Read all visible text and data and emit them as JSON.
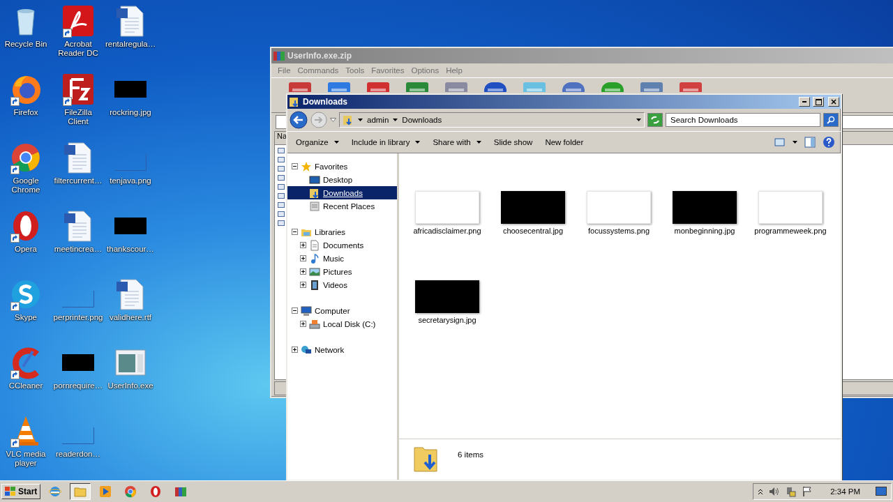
{
  "desktop": {
    "icons": [
      {
        "label": "Recycle Bin",
        "kind": "recycle",
        "shortcut": false
      },
      {
        "label": "Acrobat Reader DC",
        "kind": "acrobat",
        "shortcut": true
      },
      {
        "label": "rentalregula…",
        "kind": "doc",
        "shortcut": false
      },
      {
        "label": "Firefox",
        "kind": "firefox",
        "shortcut": true
      },
      {
        "label": "FileZilla Client",
        "kind": "filezilla",
        "shortcut": true
      },
      {
        "label": "rockring.jpg",
        "kind": "thumb-dark",
        "shortcut": false
      },
      {
        "label": "Google Chrome",
        "kind": "chrome",
        "shortcut": true
      },
      {
        "label": "filtercurrent…",
        "kind": "doc",
        "shortcut": false
      },
      {
        "label": "tenjava.png",
        "kind": "thumb-blank",
        "shortcut": false
      },
      {
        "label": "Opera",
        "kind": "opera",
        "shortcut": true
      },
      {
        "label": "meetincrea…",
        "kind": "doc",
        "shortcut": false
      },
      {
        "label": "thankscour…",
        "kind": "thumb-dark",
        "shortcut": false
      },
      {
        "label": "Skype",
        "kind": "skype",
        "shortcut": true
      },
      {
        "label": "perprinter.png",
        "kind": "thumb-blank",
        "shortcut": false
      },
      {
        "label": "validhere.rtf",
        "kind": "doc",
        "shortcut": false
      },
      {
        "label": "CCleaner",
        "kind": "ccleaner",
        "shortcut": true
      },
      {
        "label": "pornrequire…",
        "kind": "thumb-dark",
        "shortcut": false
      },
      {
        "label": "UserInfo.exe",
        "kind": "window",
        "shortcut": false
      },
      {
        "label": "VLC media player",
        "kind": "vlc",
        "shortcut": true
      },
      {
        "label": "readerdon…",
        "kind": "thumb-blank",
        "shortcut": false
      }
    ]
  },
  "winrar": {
    "title": "UserInfo.exe.zip",
    "menu": [
      "File",
      "Commands",
      "Tools",
      "Favorites",
      "Options",
      "Help"
    ],
    "list": {
      "column_1": "Na"
    }
  },
  "explorer": {
    "title": "Downloads",
    "breadcrumbs": [
      "admin",
      "Downloads"
    ],
    "search": {
      "placeholder": "Search Downloads"
    },
    "toolbar": [
      {
        "label": "Organize",
        "dropdown": true
      },
      {
        "label": "Include in library",
        "dropdown": true
      },
      {
        "label": "Share with",
        "dropdown": true
      },
      {
        "label": "Slide show",
        "dropdown": false
      },
      {
        "label": "New folder",
        "dropdown": false
      }
    ],
    "nav": [
      {
        "label": "Favorites",
        "kind": "star",
        "expanded": true,
        "children": [
          {
            "label": "Desktop",
            "kind": "monitor",
            "selected": false
          },
          {
            "label": "Downloads",
            "kind": "downloads",
            "selected": true
          },
          {
            "label": "Recent Places",
            "kind": "recent",
            "selected": false
          }
        ]
      },
      {
        "label": "Libraries",
        "kind": "library",
        "expanded": true,
        "children": [
          {
            "label": "Documents",
            "kind": "document",
            "selected": false,
            "expanded": false
          },
          {
            "label": "Music",
            "kind": "music",
            "selected": false,
            "expanded": false
          },
          {
            "label": "Pictures",
            "kind": "pictures",
            "selected": false,
            "expanded": false
          },
          {
            "label": "Videos",
            "kind": "film",
            "selected": false,
            "expanded": false
          }
        ]
      },
      {
        "label": "Computer",
        "kind": "computer",
        "expanded": true,
        "children": [
          {
            "label": "Local Disk (C:)",
            "kind": "disk",
            "selected": false,
            "expanded": false
          }
        ]
      },
      {
        "label": "Network",
        "kind": "network",
        "expanded": false
      }
    ],
    "files": [
      {
        "name": "africadisclaimer.png",
        "dark": false
      },
      {
        "name": "choosecentral.jpg",
        "dark": true
      },
      {
        "name": "focussystems.png",
        "dark": false
      },
      {
        "name": "monbeginning.jpg",
        "dark": true
      },
      {
        "name": "programmeweek.png",
        "dark": false
      },
      {
        "name": "secretarysign.jpg",
        "dark": true
      }
    ],
    "details": {
      "count": "6 items"
    }
  },
  "taskbar": {
    "start": "Start",
    "apps": [
      {
        "kind": "ie",
        "active": false
      },
      {
        "kind": "explorer",
        "active": true
      },
      {
        "kind": "media",
        "active": false
      },
      {
        "kind": "chrome",
        "active": false
      },
      {
        "kind": "opera",
        "active": false
      },
      {
        "kind": "winrar",
        "active": false
      }
    ],
    "clock": "2:34 PM"
  }
}
